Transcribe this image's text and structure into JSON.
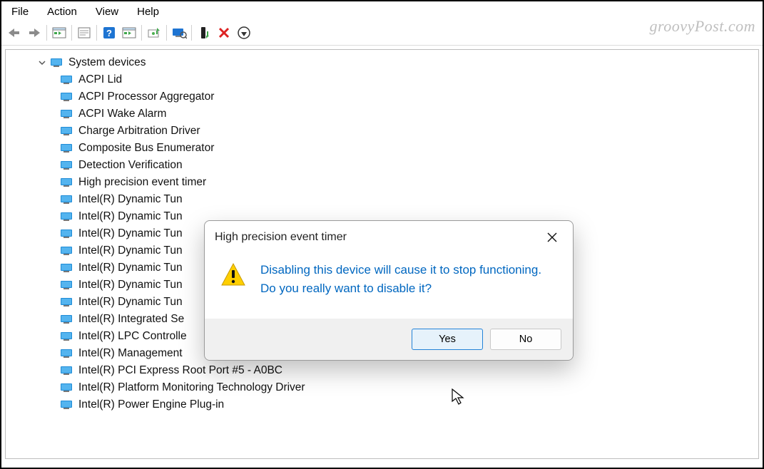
{
  "menubar": {
    "items": [
      "File",
      "Action",
      "View",
      "Help"
    ]
  },
  "watermark": "groovyPost.com",
  "toolbar": {
    "items": [
      "back",
      "forward",
      "|",
      "show-hide-tree",
      "|",
      "properties-sheet",
      "|",
      "help",
      "action-sheet",
      "|",
      "update-driver",
      "|",
      "scan-hardware",
      "|",
      "enable-device",
      "uninstall-device",
      "add-legacy"
    ]
  },
  "tree": {
    "root": {
      "label": "System devices",
      "expanded": true
    },
    "children": [
      "ACPI Lid",
      "ACPI Processor Aggregator",
      "ACPI Wake Alarm",
      "Charge Arbitration Driver",
      "Composite Bus Enumerator",
      "Detection Verification",
      "High precision event timer",
      "Intel(R) Dynamic Tun",
      "Intel(R) Dynamic Tun",
      "Intel(R) Dynamic Tun",
      "Intel(R) Dynamic Tun",
      "Intel(R) Dynamic Tun",
      "Intel(R) Dynamic Tun",
      "Intel(R) Dynamic Tun",
      "Intel(R) Integrated Se",
      "Intel(R) LPC Controlle",
      "Intel(R) Management",
      "Intel(R) PCI Express Root Port #5 - A0BC",
      "Intel(R) Platform Monitoring Technology Driver",
      "Intel(R) Power Engine Plug-in"
    ]
  },
  "dialog": {
    "title": "High precision event timer",
    "message": "Disabling this device will cause it to stop functioning. Do you really want to disable it?",
    "yes": "Yes",
    "no": "No"
  }
}
